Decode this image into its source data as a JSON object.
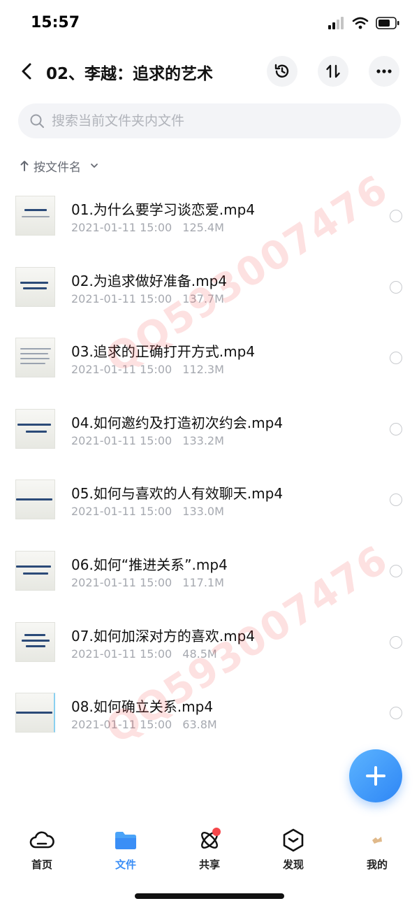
{
  "status_bar": {
    "time": "15:57",
    "icons": [
      "signal-icon",
      "wifi-icon",
      "battery-icon"
    ]
  },
  "nav": {
    "title": "02、李越：追求的艺术",
    "actions": [
      "history-icon",
      "sort-toggle-icon",
      "more-icon"
    ]
  },
  "search": {
    "placeholder": "搜索当前文件夹内文件"
  },
  "sort": {
    "label": "按文件名"
  },
  "files": [
    {
      "name": "01.为什么要学习谈恋爱.mp4",
      "date": "2021-01-11 15:00",
      "size": "125.4M"
    },
    {
      "name": "02.为追求做好准备.mp4",
      "date": "2021-01-11 15:00",
      "size": "137.7M"
    },
    {
      "name": "03.追求的正确打开方式.mp4",
      "date": "2021-01-11 15:00",
      "size": "112.3M"
    },
    {
      "name": "04.如何邀约及打造初次约会.mp4",
      "date": "2021-01-11 15:00",
      "size": "133.2M"
    },
    {
      "name": "05.如何与喜欢的人有效聊天.mp4",
      "date": "2021-01-11 15:00",
      "size": "133.0M"
    },
    {
      "name": "06.如何“推进关系”.mp4",
      "date": "2021-01-11 15:00",
      "size": "117.1M"
    },
    {
      "name": "07.如何加深对方的喜欢.mp4",
      "date": "2021-01-11 15:00",
      "size": "48.5M"
    },
    {
      "name": "08.如何确立关系.mp4",
      "date": "2021-01-11 15:00",
      "size": "63.8M"
    }
  ],
  "watermark": "QQ593007476",
  "tabs": [
    {
      "label": "首页",
      "icon": "cloud-icon",
      "active": false
    },
    {
      "label": "文件",
      "icon": "folder-icon",
      "active": true
    },
    {
      "label": "共享",
      "icon": "atom-icon",
      "active": false,
      "badge": true
    },
    {
      "label": "发现",
      "icon": "compass-icon",
      "active": false
    },
    {
      "label": "我的",
      "icon": "avatar-icon",
      "active": false
    }
  ],
  "colors": {
    "accent": "#3a8ef6",
    "fab": "#2e86f5",
    "badge": "#f5464a",
    "meta_text": "#a6a9b0"
  }
}
